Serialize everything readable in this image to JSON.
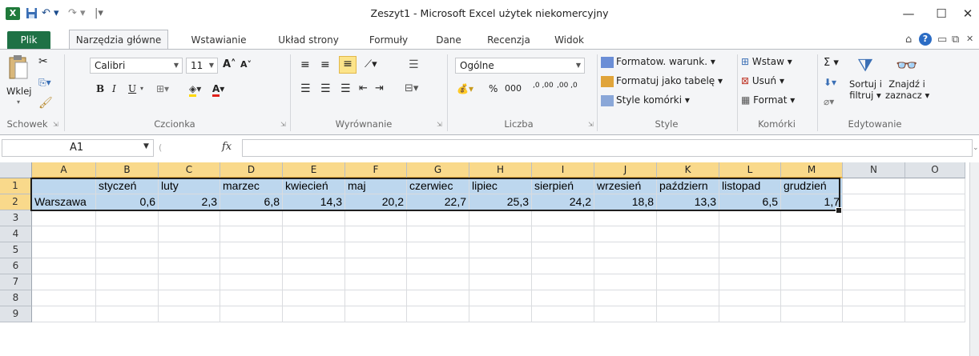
{
  "window": {
    "title": "Zeszyt1  -  Microsoft Excel użytek niekomercyjny",
    "logo": "X",
    "quick_access": {
      "save_icon": "save-icon",
      "undo": "↶ ▾",
      "redo": "↷ ▾",
      "customize": "|▾"
    },
    "controls": {
      "minimize": "—",
      "maximize": "☐",
      "close": "✕"
    }
  },
  "tabs": [
    {
      "label": "Plik"
    },
    {
      "label": "Narzędzia główne"
    },
    {
      "label": "Wstawianie"
    },
    {
      "label": "Układ strony"
    },
    {
      "label": "Formuły"
    },
    {
      "label": "Dane"
    },
    {
      "label": "Recenzja"
    },
    {
      "label": "Widok"
    }
  ],
  "ribbon": {
    "clipboard": {
      "paste": "Wklej",
      "group": "Schowek"
    },
    "font": {
      "name": "Calibri",
      "size": "11",
      "bold": "B",
      "italic": "I",
      "underline": "U",
      "grow": "A˄",
      "shrink": "A˅",
      "group": "Czcionka"
    },
    "alignment": {
      "group": "Wyrównanie"
    },
    "number": {
      "format": "Ogólne",
      "percent": "%",
      "thousands": "000",
      "inc": ",0 ,00",
      "dec": ",00 ,0",
      "group": "Liczba"
    },
    "styles": {
      "conditional": "Formatow. warunk. ▾",
      "table": "Formatuj jako tabelę ▾",
      "cell": "Style komórki ▾",
      "group": "Style"
    },
    "cells": {
      "insert": "Wstaw ▾",
      "delete": "Usuń ▾",
      "format": "Format ▾",
      "group": "Komórki"
    },
    "editing": {
      "sigma": "Σ ▾",
      "sort": "Sortuj i filtruj ▾",
      "find": "Znajdź i zaznacz ▾",
      "sort1": "Sortuj i",
      "sort2": "filtruj ▾",
      "find1": "Znajdź i",
      "find2": "zaznacz ▾",
      "group": "Edytowanie"
    }
  },
  "formula_bar": {
    "name_box": "A1",
    "fx": "fx",
    "value": ""
  },
  "grid": {
    "columns": [
      "A",
      "B",
      "C",
      "D",
      "E",
      "F",
      "G",
      "H",
      "I",
      "J",
      "K",
      "L",
      "M",
      "N",
      "O"
    ],
    "rows": [
      "1",
      "2",
      "3",
      "4",
      "5",
      "6",
      "7",
      "8",
      "9"
    ],
    "row1": [
      "",
      "styczeń",
      "luty",
      "marzec",
      "kwiecień",
      "maj",
      "czerwiec",
      "lipiec",
      "sierpień",
      "wrzesień",
      "październ",
      "listopad",
      "grudzień"
    ],
    "row2_label": "Warszawa",
    "row2_values": [
      "0,6",
      "2,3",
      "6,8",
      "14,3",
      "20,2",
      "22,7",
      "25,3",
      "24,2",
      "18,8",
      "13,3",
      "6,5",
      "1,7"
    ]
  },
  "colors": {
    "selection_fill": "#bdd7ee",
    "file_tab": "#1e7145",
    "header_selected": "#f9d98b"
  }
}
